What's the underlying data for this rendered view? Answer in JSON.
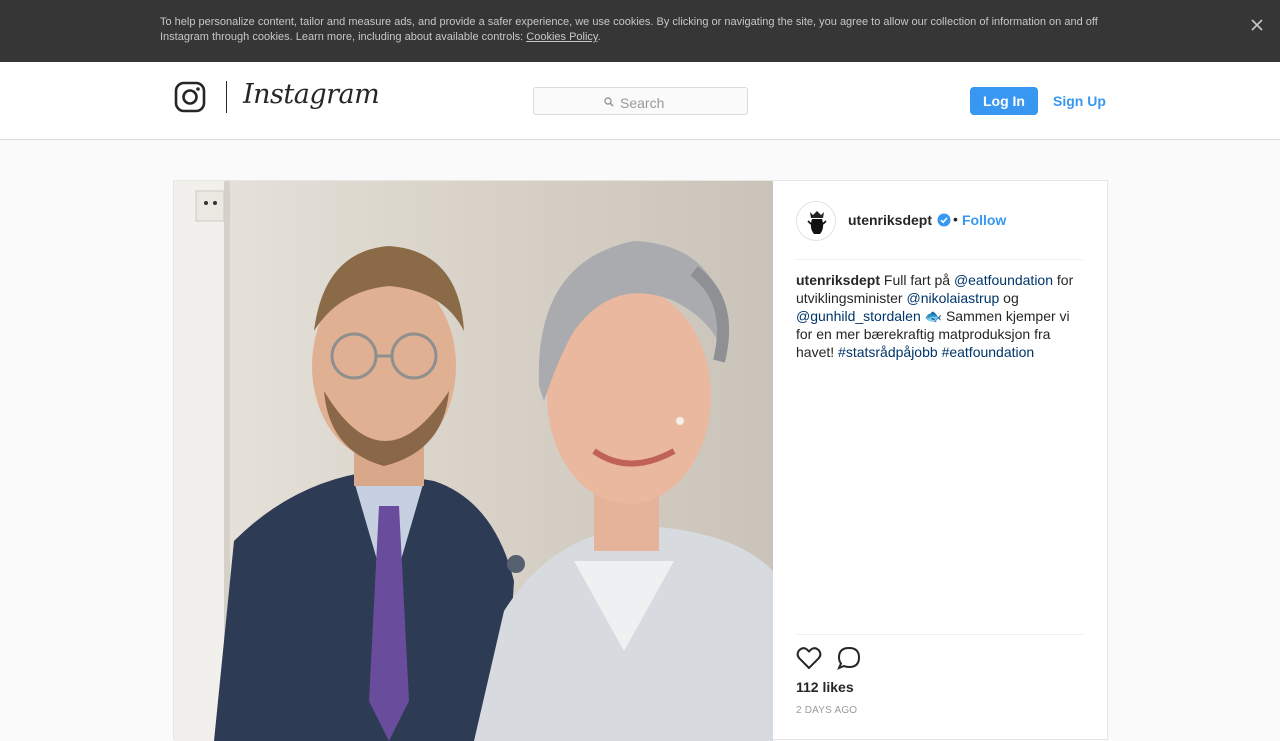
{
  "cookie_banner": {
    "text": "To help personalize content, tailor and measure ads, and provide a safer experience, we use cookies. By clicking or navigating the site, you agree to allow our collection of information on and off Instagram through cookies. Learn more, including about available controls: ",
    "link_label": "Cookies Policy",
    "close_icon": "close-icon"
  },
  "header": {
    "logo_icon": "instagram-glyph-icon",
    "wordmark": "Instagram",
    "search": {
      "placeholder": "Search",
      "icon": "search-icon"
    },
    "login_label": "Log In",
    "signup_label": "Sign Up"
  },
  "post": {
    "author": {
      "username": "utenriksdept",
      "verified_icon": "verified-badge-icon",
      "separator": "•",
      "follow_label": "Follow"
    },
    "caption": {
      "username": "utenriksdept",
      "segments": [
        {
          "text": " Full fart på "
        },
        {
          "mention": "@eatfoundation"
        },
        {
          "text": " for utviklingsminister "
        },
        {
          "mention": "@nikolaiastrup"
        },
        {
          "text": " og "
        },
        {
          "mention": "@gunhild_stordalen"
        },
        {
          "text": " 🐟 Sammen kjemper vi for en mer bærekraftig matproduksjon fra havet! "
        },
        {
          "mention": "#statsrådpåjobb"
        },
        {
          "text": " "
        },
        {
          "mention": "#eatfoundation"
        }
      ]
    },
    "likes": "112 likes",
    "timestamp": "2 DAYS AGO",
    "icons": {
      "like": "heart-icon",
      "comment": "comment-icon"
    }
  },
  "colors": {
    "accent": "#3897f0",
    "mention": "#003569",
    "cookie_bg": "#363636",
    "border": "#dbdbdb"
  }
}
